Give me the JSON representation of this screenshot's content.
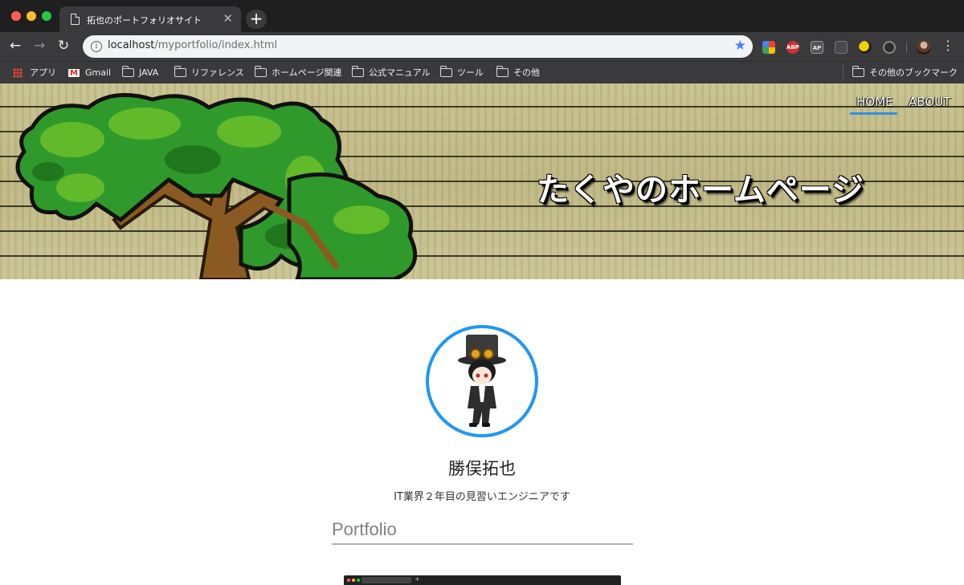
{
  "browser": {
    "tab_title": "拓也のポートフォリオサイト",
    "tab_close": "✕",
    "new_tab": "+",
    "back": "←",
    "forward": "→",
    "reload": "↻",
    "info": "i",
    "url_host": "localhost",
    "url_path": "/myportfolio/index.html",
    "bookmark_star": "★",
    "ext_abp": "ABP",
    "ext_ap": "AP",
    "menu": "⋮",
    "bookmarks": [
      {
        "label": "アプリ",
        "icon": "apps-icon"
      },
      {
        "label": "Gmail",
        "icon": "gmail-icon"
      },
      {
        "label": "JAVA",
        "icon": "folder-icon"
      },
      {
        "label": "リファレンス",
        "icon": "folder-icon"
      },
      {
        "label": "ホームページ関連",
        "icon": "folder-icon"
      },
      {
        "label": "公式マニュアル",
        "icon": "folder-icon"
      },
      {
        "label": "ツール",
        "icon": "folder-icon"
      },
      {
        "label": "その他",
        "icon": "folder-icon"
      }
    ],
    "other_bookmarks": "その他のブックマーク"
  },
  "page": {
    "nav": {
      "home": "HOME",
      "about": "ABOUT",
      "active_color": "#2f8ee8"
    },
    "hero_title": "たくやのホームページ",
    "profile": {
      "name": "勝俣拓也",
      "tagline": "IT業界２年目の見習いエンジニアです",
      "avatar_border_color": "#2196f3"
    },
    "section_title": "Portfolio"
  }
}
